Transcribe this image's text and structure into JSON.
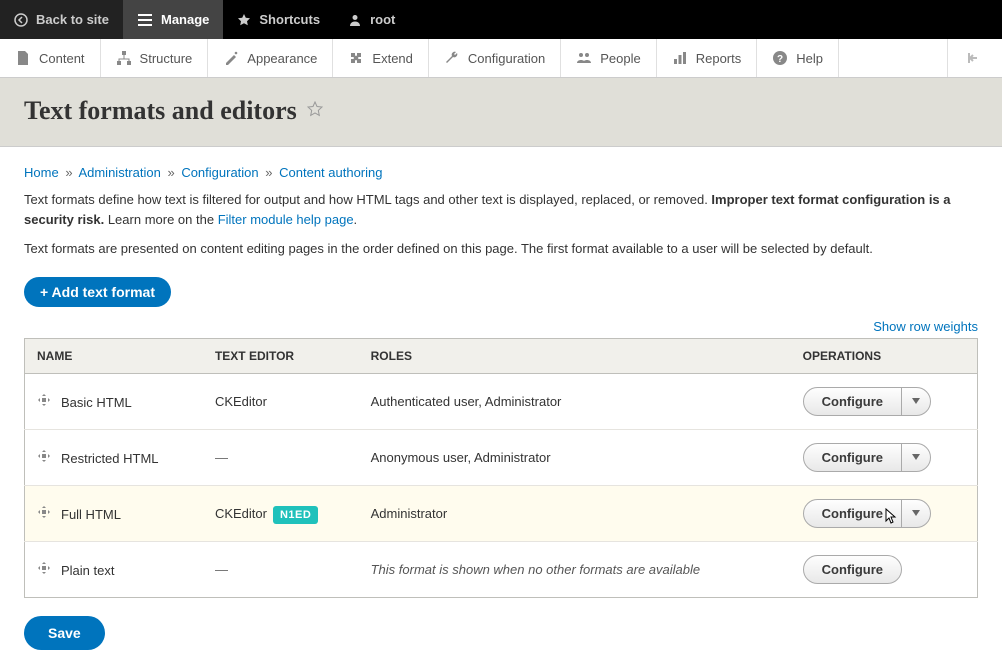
{
  "toolbar": {
    "back": "Back to site",
    "manage": "Manage",
    "shortcuts": "Shortcuts",
    "user": "root"
  },
  "adminMenu": {
    "content": "Content",
    "structure": "Structure",
    "appearance": "Appearance",
    "extend": "Extend",
    "configuration": "Configuration",
    "people": "People",
    "reports": "Reports",
    "help": "Help"
  },
  "page": {
    "title": "Text formats and editors"
  },
  "breadcrumb": {
    "home": "Home",
    "admin": "Administration",
    "config": "Configuration",
    "content_auth": "Content authoring"
  },
  "desc1_a": "Text formats define how text is filtered for output and how HTML tags and other text is displayed, replaced, or removed. ",
  "desc1_b": "Improper text format configuration is a security risk.",
  "desc1_c": " Learn more on the ",
  "desc1_link": "Filter module help page",
  "desc1_d": ".",
  "desc2": "Text formats are presented on content editing pages in the order defined on this page. The first format available to a user will be selected by default.",
  "addButton": "+ Add text format",
  "showWeights": "Show row weights",
  "table": {
    "headers": {
      "name": "Name",
      "editor": "Text Editor",
      "roles": "Roles",
      "ops": "Operations"
    },
    "rows": [
      {
        "name": "Basic HTML",
        "editor": "CKEditor",
        "badge": "",
        "roles": "Authenticated user, Administrator",
        "dropdown": true,
        "highlighted": false,
        "italic": false
      },
      {
        "name": "Restricted HTML",
        "editor": "—",
        "badge": "",
        "roles": "Anonymous user, Administrator",
        "dropdown": true,
        "highlighted": false,
        "italic": false
      },
      {
        "name": "Full HTML",
        "editor": "CKEditor",
        "badge": "N1ED",
        "roles": "Administrator",
        "dropdown": true,
        "highlighted": true,
        "italic": false
      },
      {
        "name": "Plain text",
        "editor": "—",
        "badge": "",
        "roles": "This format is shown when no other formats are available",
        "dropdown": false,
        "highlighted": false,
        "italic": true
      }
    ],
    "configure": "Configure"
  },
  "save": "Save"
}
